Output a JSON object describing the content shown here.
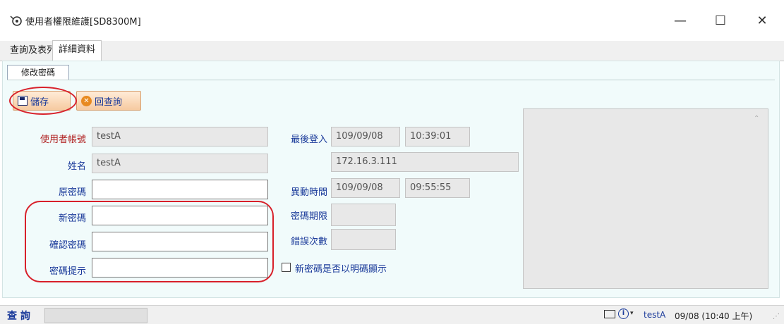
{
  "window": {
    "title": "使用者權限維護[SD8300M]",
    "min": "—",
    "max": "☐",
    "close": "✕"
  },
  "tabs": [
    {
      "label": "查詢及表列"
    },
    {
      "label": "詳細資料"
    }
  ],
  "subtab": {
    "label": "修改密碼"
  },
  "toolbar": {
    "save_label": "儲存",
    "back_label": "回查詢"
  },
  "form": {
    "user_id_label": "使用者帳號",
    "user_id_value": "testA",
    "name_label": "姓名",
    "name_value": "testA",
    "old_pwd_label": "原密碼",
    "old_pwd_value": "",
    "new_pwd_label": "新密碼",
    "new_pwd_value": "",
    "confirm_pwd_label": "確認密碼",
    "confirm_pwd_value": "",
    "pwd_hint_label": "密碼提示",
    "pwd_hint_value": "",
    "last_login_label": "最後登入",
    "last_login_date": "109/09/08",
    "last_login_time": "10:39:01",
    "ip_value": "172.16.3.111",
    "changed_label": "異動時間",
    "changed_date": "109/09/08",
    "changed_time": "09:55:55",
    "pwd_expiry_label": "密碼期限",
    "pwd_expiry_value": "",
    "error_count_label": "錯誤次數",
    "error_count_value": "",
    "show_plain_label": "新密碼是否以明碼顯示"
  },
  "status": {
    "label": "查 詢",
    "user": "testA",
    "datetime": "09/08 (10:40 上午)"
  },
  "colors": {
    "annotation": "#d8202a",
    "label_blue": "#1a3a9a",
    "label_red": "#b02020",
    "panel_bg": "#f1fbfb"
  },
  "icons": [
    "app-icon",
    "floppy-icon",
    "close-circle-icon",
    "book-icon",
    "info-icon",
    "dropdown-icon"
  ]
}
